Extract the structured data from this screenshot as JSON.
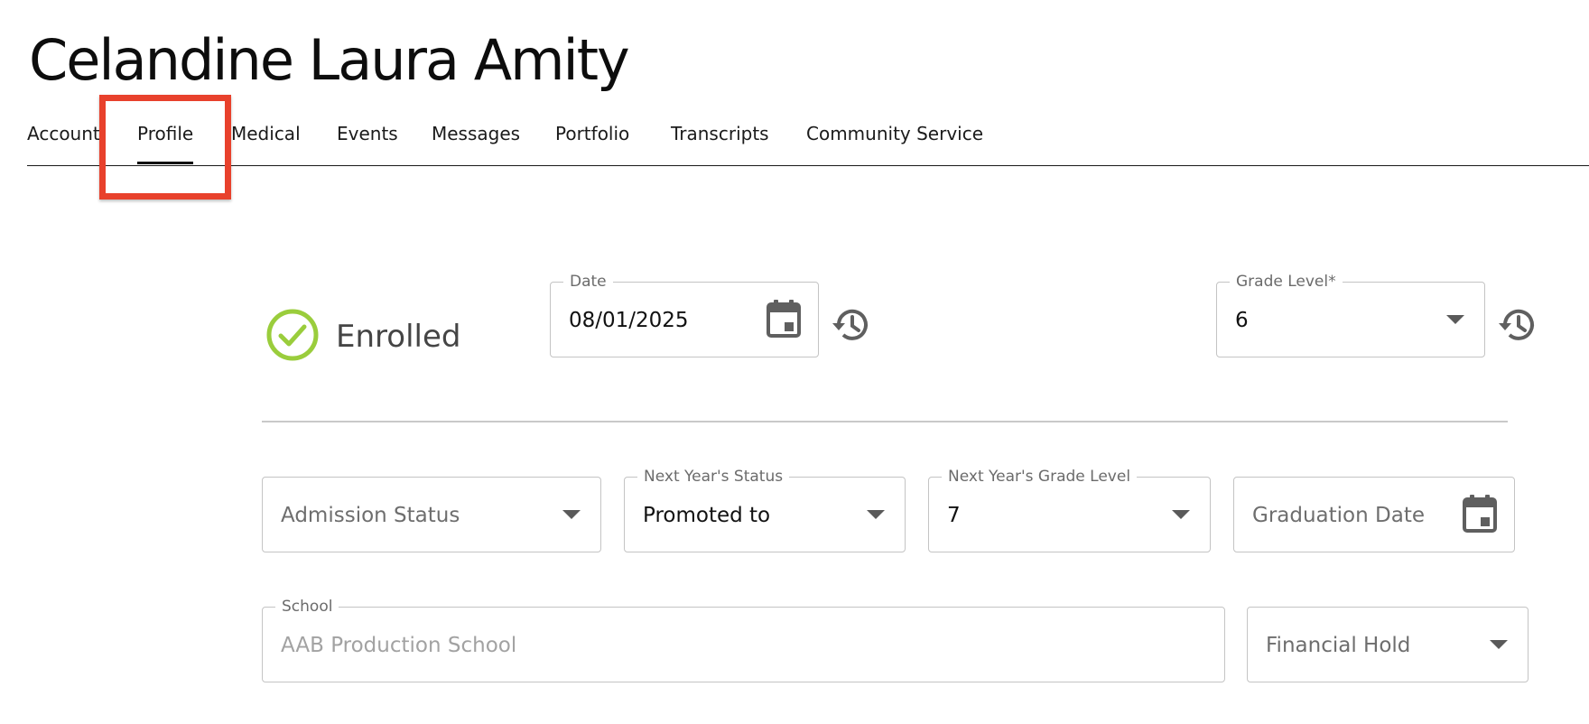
{
  "header": {
    "title": "Celandine Laura Amity"
  },
  "tabs": [
    {
      "label": "Account",
      "active": false
    },
    {
      "label": "Profile",
      "active": true
    },
    {
      "label": "Medical",
      "active": false
    },
    {
      "label": "Events",
      "active": false
    },
    {
      "label": "Messages",
      "active": false
    },
    {
      "label": "Portfolio",
      "active": false
    },
    {
      "label": "Transcripts",
      "active": false
    },
    {
      "label": "Community Service",
      "active": false
    }
  ],
  "status": {
    "label": "Enrolled",
    "icon": "check-circle-icon",
    "color": "#9acd3c"
  },
  "date_field": {
    "label": "Date",
    "value": "08/01/2025",
    "icon": "calendar-icon"
  },
  "grade_level": {
    "label": "Grade Level",
    "required_mark": "*",
    "value": "6"
  },
  "admission_status": {
    "placeholder": "Admission Status"
  },
  "next_year_status": {
    "label": "Next Year's Status",
    "value": "Promoted to"
  },
  "next_year_grade": {
    "label": "Next Year's Grade Level",
    "value": "7"
  },
  "graduation_date": {
    "placeholder": "Graduation Date",
    "icon": "calendar-icon"
  },
  "school": {
    "label": "School",
    "value": "AAB Production School"
  },
  "financial_hold": {
    "placeholder": "Financial Hold"
  },
  "colors": {
    "highlight": "#e8412c",
    "status_check": "#9acd3c",
    "icon_gray": "#5f5f5f"
  }
}
